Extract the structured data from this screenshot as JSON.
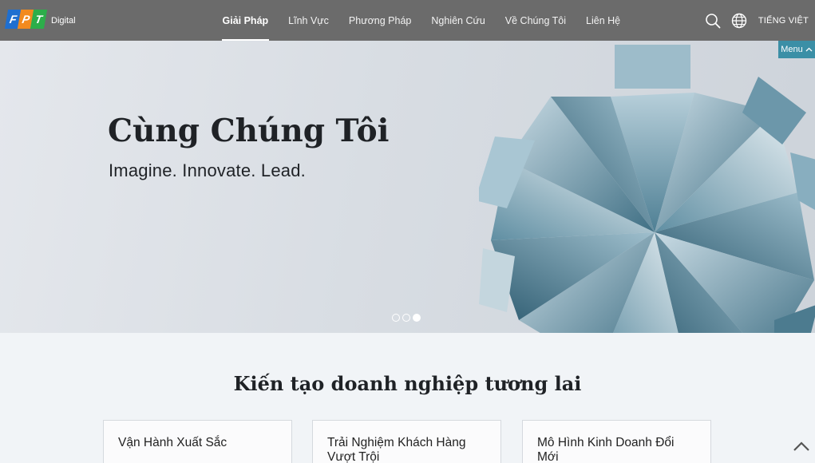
{
  "brand": {
    "logo_letters": [
      "F",
      "P",
      "T"
    ],
    "logo_sub": "Digital",
    "colors": {
      "f": "#1f6fd0",
      "p": "#f28a1e",
      "t": "#2cae4a"
    }
  },
  "nav": {
    "items": [
      {
        "label": "Giải Pháp",
        "active": true
      },
      {
        "label": "Lĩnh Vực"
      },
      {
        "label": "Phương Pháp"
      },
      {
        "label": "Nghiên Cứu"
      },
      {
        "label": "Về Chúng Tôi"
      },
      {
        "label": "Liên Hệ"
      }
    ]
  },
  "tools": {
    "search_icon": "search-icon",
    "globe_icon": "globe-icon",
    "language": "TIẾNG VIỆT"
  },
  "menu_tab": {
    "label": "Menu"
  },
  "hero": {
    "title": "Cùng Chúng Tôi",
    "subtitle": "Imagine. Innovate. Lead.",
    "slides": 3,
    "active_slide": 3
  },
  "section": {
    "title": "Kiến tạo doanh nghiệp tương lai",
    "cards": [
      {
        "label": "Vận Hành Xuất Sắc"
      },
      {
        "label": "Trải Nghiệm Khách Hàng Vượt Trội"
      },
      {
        "label": "Mô Hình Kinh Doanh Đổi Mới"
      }
    ]
  },
  "colors": {
    "topbar": "#6b6b6b",
    "accent": "#3b8fa6",
    "hero_bg": "#d8dde3",
    "crystal_dark": "#3d6d82",
    "crystal_light": "#a9c6d3"
  }
}
